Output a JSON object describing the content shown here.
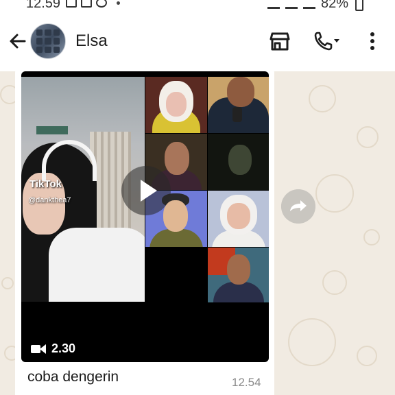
{
  "status_bar": {
    "time": "12.59",
    "battery": "82%"
  },
  "header": {
    "contact_name": "Elsa",
    "icons": [
      "back-arrow-icon",
      "shop-icon",
      "phone-icon",
      "more-vertical-icon"
    ]
  },
  "message": {
    "watermark_logo": "TikTok",
    "watermark_handle": "@dankthea7",
    "video_duration": "2.30",
    "caption": "coba dengerin",
    "time": "12.54"
  },
  "colors": {
    "header_bg": "#ffffff",
    "wallpaper_bg": "#f1ebe2",
    "bubble_bg": "#ffffff",
    "time_text": "#8a8a8a"
  }
}
